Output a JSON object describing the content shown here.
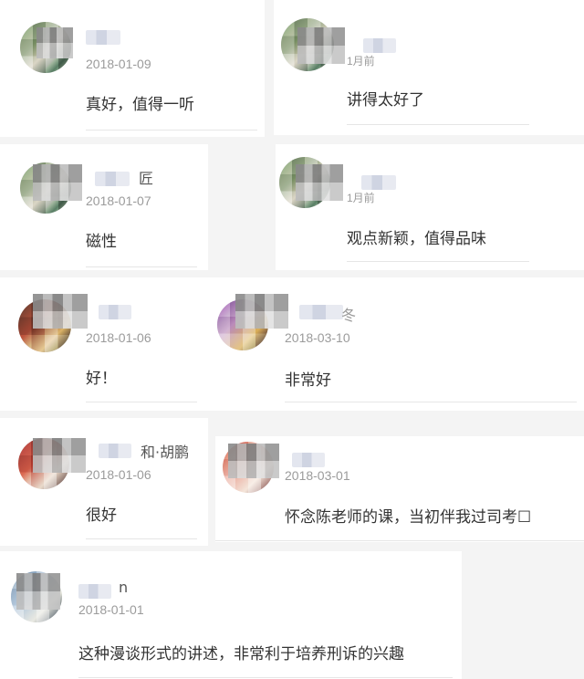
{
  "comments": [
    {
      "date": "2018-01-09",
      "text": "真好，值得一听"
    },
    {
      "date": "1月前",
      "text": "讲得太好了"
    },
    {
      "name_suffix": "匠",
      "date": "2018-01-07",
      "text": "磁性"
    },
    {
      "date": "1月前",
      "text": "观点新颖，值得品味"
    },
    {
      "date": "2018-01-06",
      "text": "好！"
    },
    {
      "name_suffix": "冬",
      "date": "2018-03-10",
      "text": "非常好"
    },
    {
      "name_suffix": "和·胡鹏",
      "date": "2018-01-06",
      "text": "很好"
    },
    {
      "date": "2018-03-01",
      "text": "怀念陈老师的课，当初伴我过司考☐"
    },
    {
      "name_suffix": "n",
      "date": "2018-01-01",
      "text": "这种漫谈形式的讲述，非常利于培养刑诉的兴趣"
    }
  ]
}
